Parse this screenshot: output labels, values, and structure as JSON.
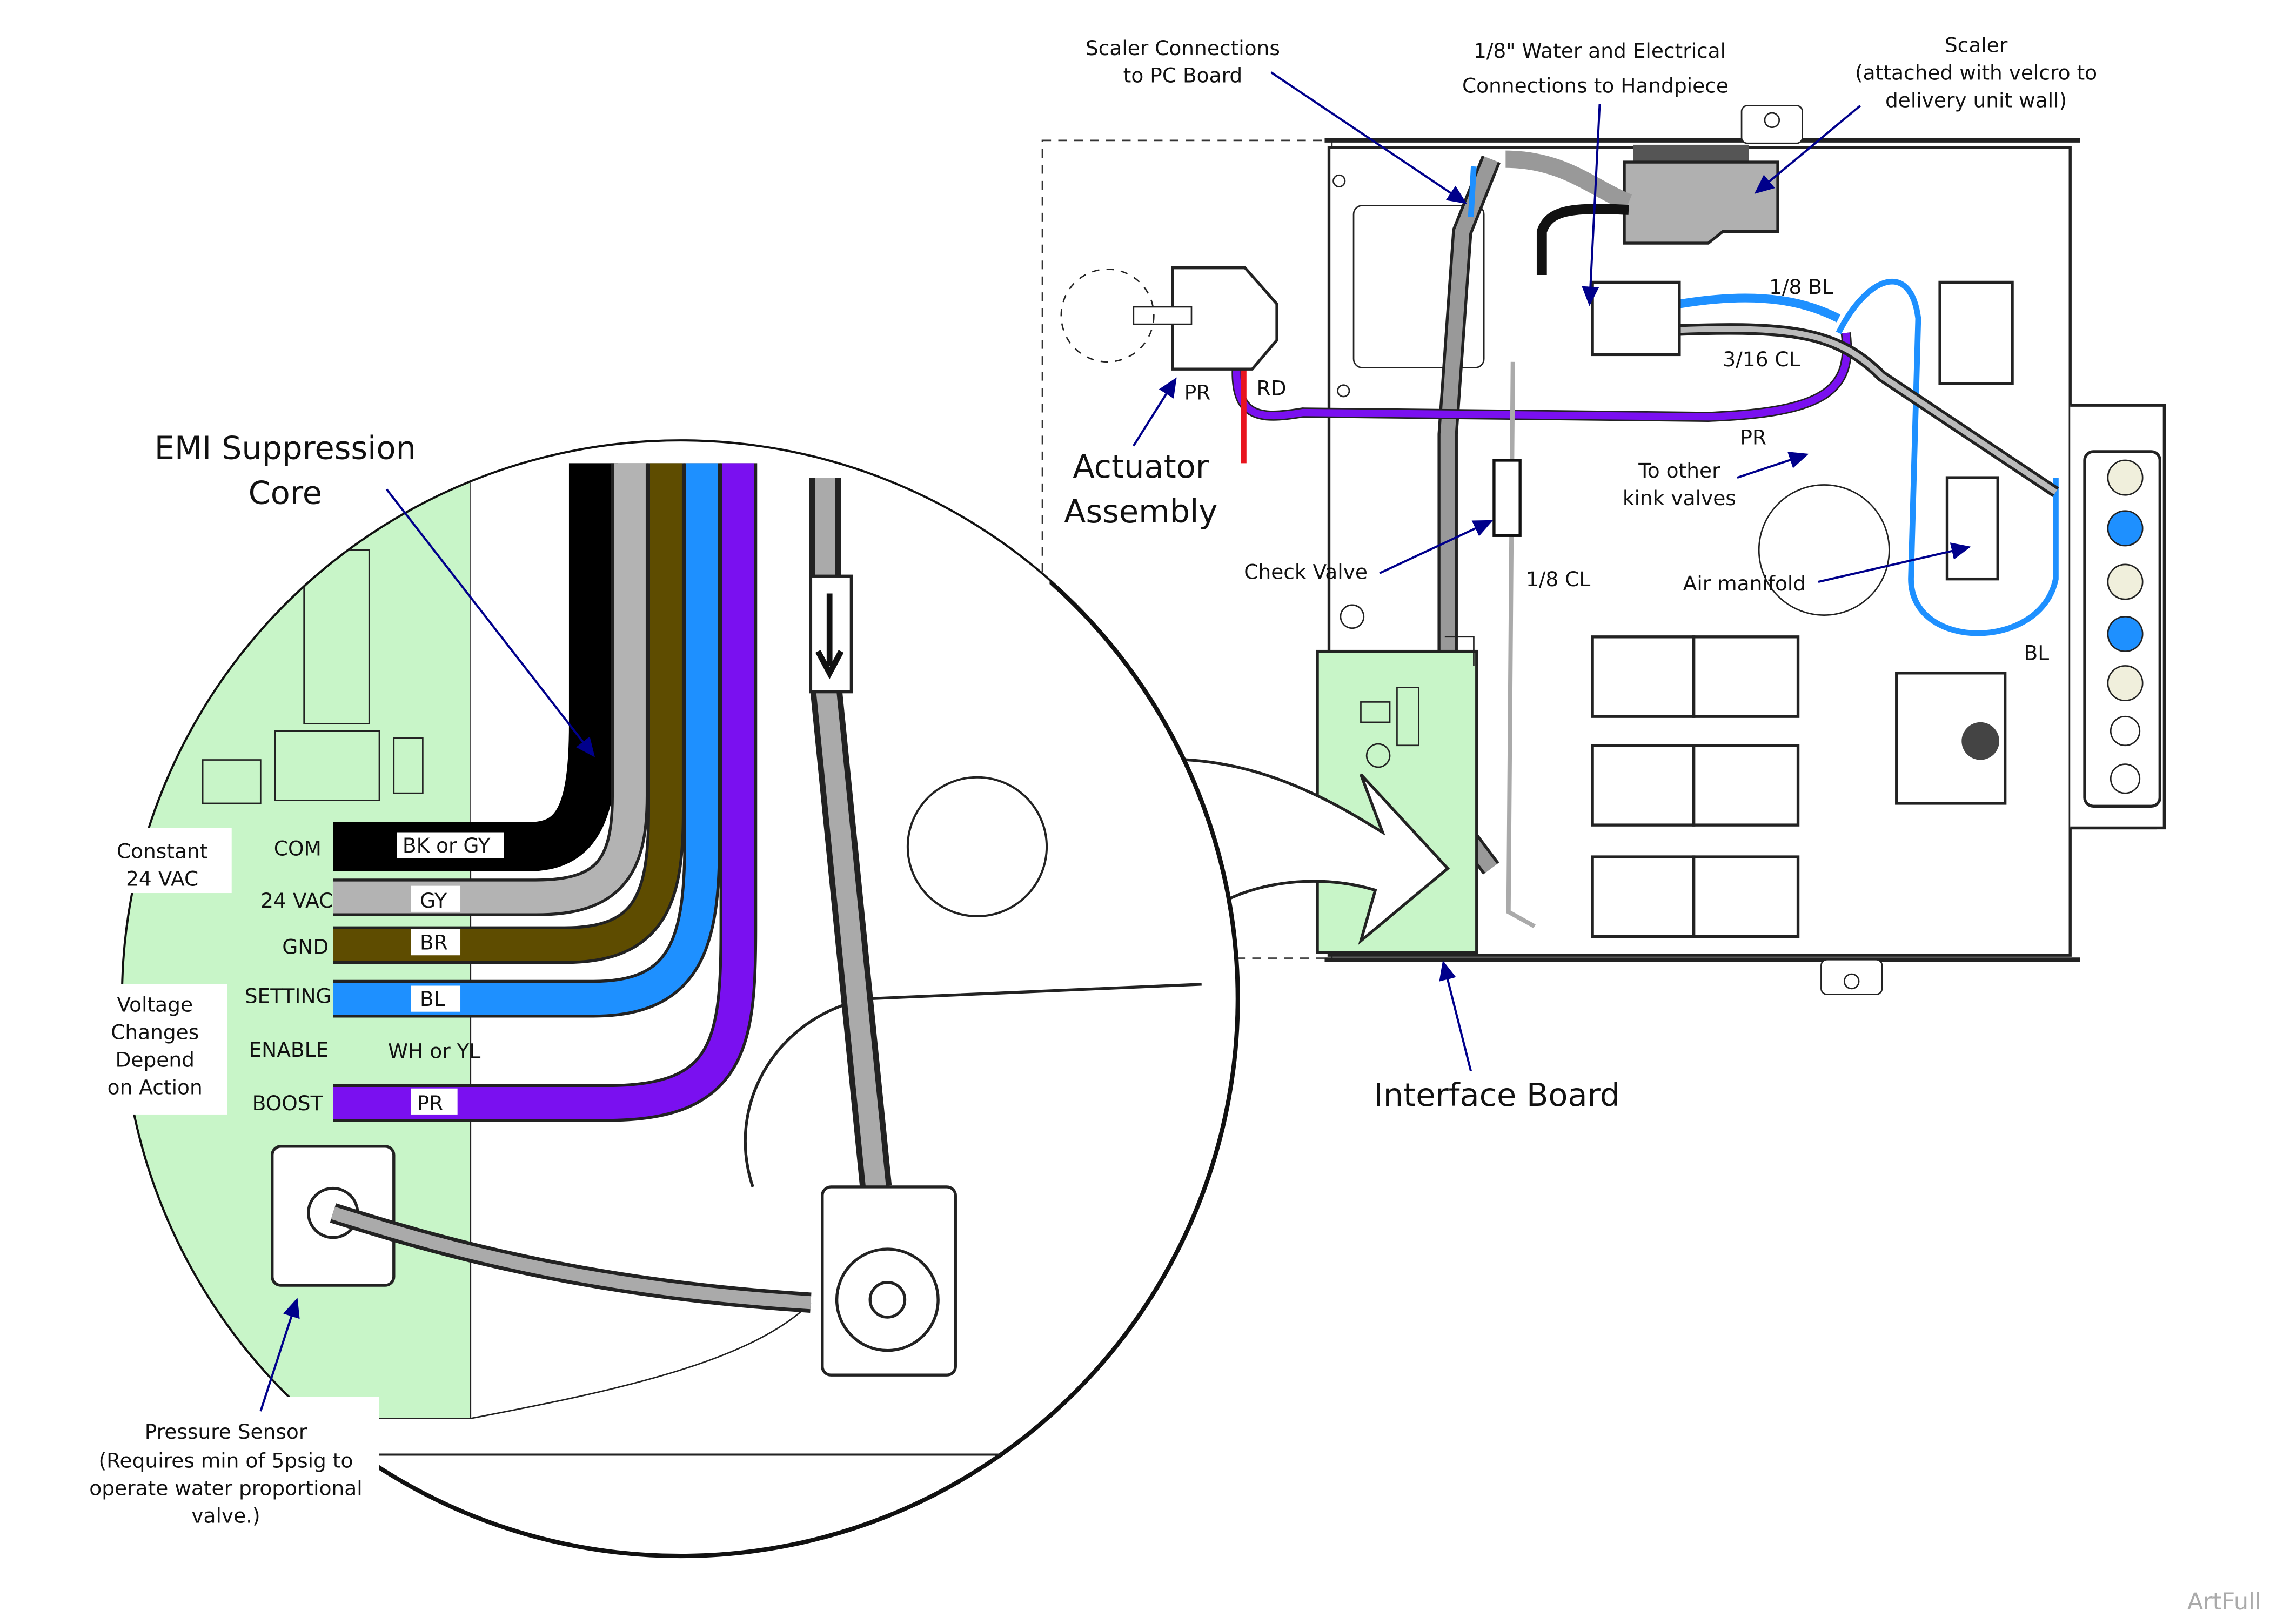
{
  "callouts": {
    "scaler_connections": [
      "Scaler Connections",
      "to PC Board"
    ],
    "water_electrical": [
      "1/8\" Water and Electrical",
      "Connections to Handpiece"
    ],
    "scaler": [
      "Scaler",
      "(attached with velcro to",
      "delivery unit wall)"
    ],
    "actuator_assembly": [
      "Actuator",
      "Assembly"
    ],
    "check_valve": "Check Valve",
    "to_other_kink_valves": [
      "To other",
      "kink valves"
    ],
    "air_manifold": "Air manifold",
    "interface_board": "Interface Board",
    "emi_core": [
      "EMI Suppression",
      "Core"
    ],
    "pressure_sensor": [
      "Pressure Sensor",
      "(Requires min of 5psig to",
      "operate water proportional",
      "valve.)"
    ],
    "constant_24vac": [
      "Constant",
      "24 VAC"
    ],
    "voltage_changes": [
      "Voltage",
      "Changes",
      "Depend",
      "on Action"
    ]
  },
  "tubing_labels": {
    "pr_actuator": "PR",
    "rd": "RD",
    "bl_1_8": "1/8 BL",
    "cl_3_16": "3/16 CL",
    "pr_main": "PR",
    "cl_1_8": "1/8 CL",
    "bl": "BL"
  },
  "wires": [
    {
      "signal": "COM",
      "color_label": "BK or GY",
      "color": "#000000"
    },
    {
      "signal": "24 VAC",
      "color_label": "GY",
      "color": "#b3b3b3"
    },
    {
      "signal": "GND",
      "color_label": "BR",
      "color": "#5e4c00"
    },
    {
      "signal": "SETTING",
      "color_label": "BL",
      "color": "#1e90ff"
    },
    {
      "signal": "ENABLE",
      "color_label": "WH or YL",
      "color": "#ffffff"
    },
    {
      "signal": "BOOST",
      "color_label": "PR",
      "color": "#7a10f0"
    }
  ],
  "colors": {
    "pcb": "#c8f5c8",
    "arrow": "#00008b",
    "purple_tube": "#7a10f0",
    "blue_tube": "#1e90ff",
    "gray_tube": "#999999",
    "red_tube": "#e8141e"
  },
  "watermark": "ArtFull"
}
